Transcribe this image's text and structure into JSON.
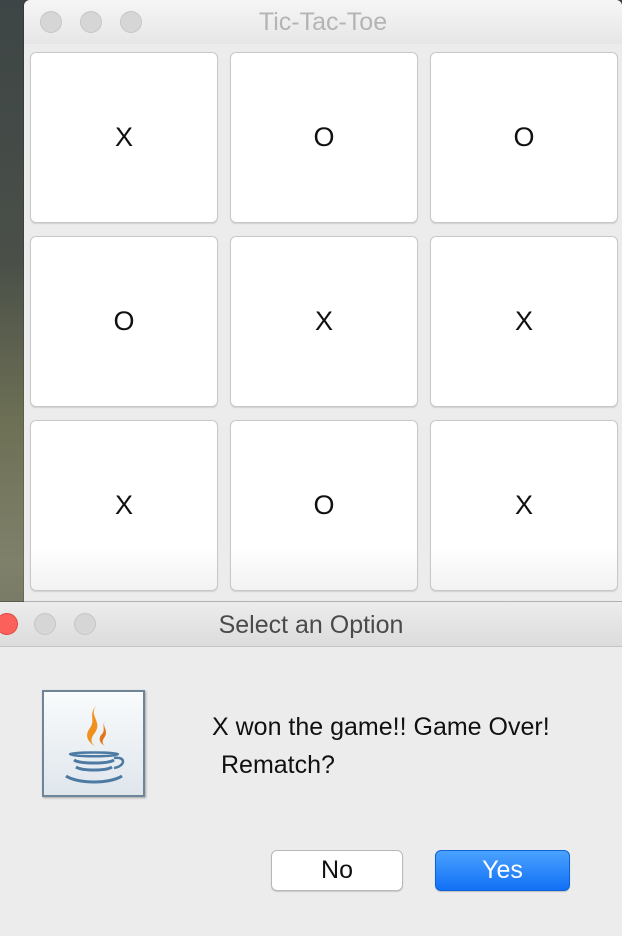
{
  "game_window": {
    "title": "Tic-Tac-Toe",
    "board": [
      [
        "X",
        "O",
        "O"
      ],
      [
        "O",
        "X",
        "X"
      ],
      [
        "X",
        "O",
        "X"
      ]
    ]
  },
  "dialog": {
    "title": "Select an Option",
    "icon": "java-cup-icon",
    "message_line1": "X won the game!! Game Over!",
    "message_line2": "Rematch?",
    "no_label": "No",
    "yes_label": "Yes"
  },
  "colors": {
    "yes_button": "#1f7bf9",
    "close_button": "#fc605b"
  }
}
